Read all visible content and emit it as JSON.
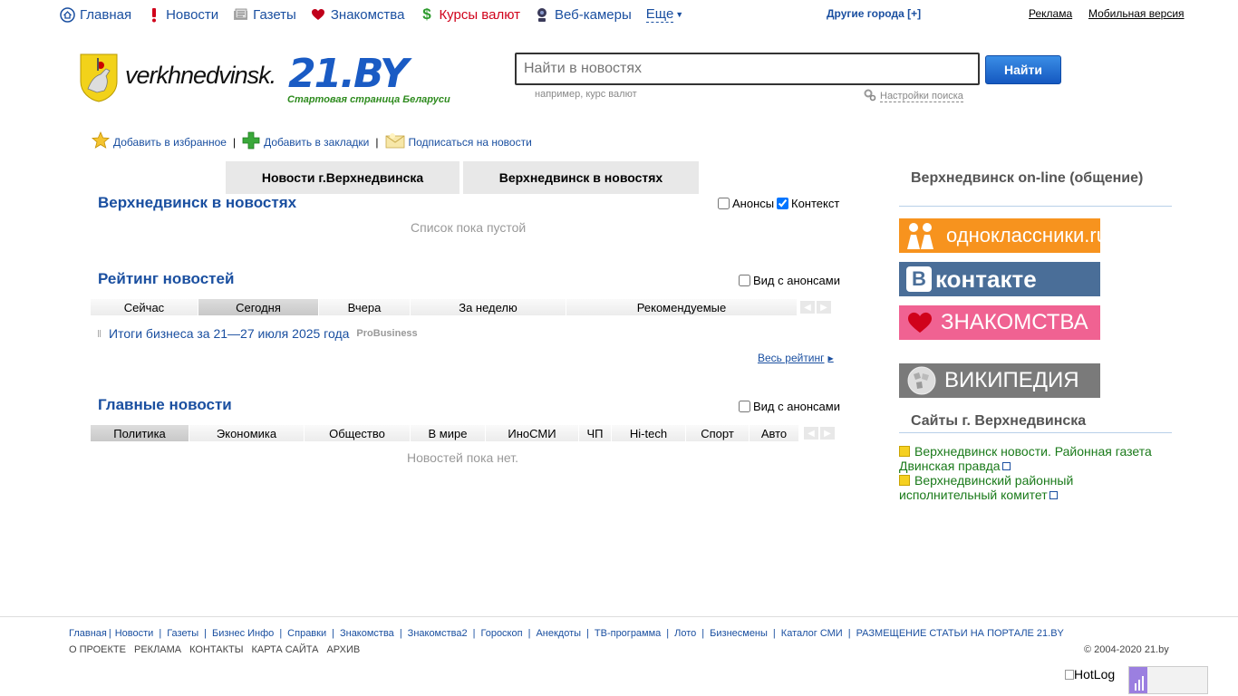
{
  "topnav": {
    "items": [
      {
        "label": "Главная",
        "icon": "home-icon",
        "color": "#1a4fa0"
      },
      {
        "label": "Новости",
        "icon": "exclamation-icon",
        "color": "#1a4fa0"
      },
      {
        "label": "Газеты",
        "icon": "newspaper-icon",
        "color": "#1a4fa0"
      },
      {
        "label": "Знакомства",
        "icon": "heart-icon",
        "color": "#1a4fa0"
      },
      {
        "label": "Курсы валют",
        "icon": "dollar-icon",
        "color": "#d0021b"
      },
      {
        "label": "Веб-камеры",
        "icon": "webcam-icon",
        "color": "#1a4fa0"
      }
    ],
    "more_label": "Еще",
    "other_cities": "Другие города [+]",
    "ads": "Реклама",
    "mobile": "Мобильная версия"
  },
  "logo": {
    "site_name": "verkhnedvinsk.",
    "brand": "21.BY",
    "tagline": "Стартовая страница Беларуси"
  },
  "search": {
    "placeholder": "Найти в новостях",
    "button": "Найти",
    "hint": "например, курс валют",
    "settings": "Настройки поиска"
  },
  "actions": {
    "favorites": "Добавить в избранное",
    "bookmarks": "Добавить в закладки",
    "subscribe": "Подписаться на новости"
  },
  "tabs": {
    "city_news": "Новости г.Верхнедвинска",
    "in_news": "Верхнедвинск в новостях"
  },
  "section_in_news": {
    "title": "Верхнедвинск в новостях",
    "announcements": "Анонсы",
    "context": "Контекст",
    "empty": "Список пока пустой"
  },
  "rating": {
    "title": "Рейтинг новостей",
    "with_announcements": "Вид с анонсами",
    "tabs": [
      "Сейчас",
      "Сегодня",
      "Вчера",
      "За неделю",
      "Рекомендуемые"
    ],
    "item_title": "Итоги бизнеса за 21—27 июля 2025 года",
    "item_source": "ProBusiness",
    "all": "Весь рейтинг"
  },
  "main_news": {
    "title": "Главные новости",
    "with_announcements": "Вид с анонсами",
    "tabs": [
      "Политика",
      "Экономика",
      "Общество",
      "В мире",
      "ИноСМИ",
      "ЧП",
      "Hi-tech",
      "Спорт",
      "Авто"
    ],
    "empty": "Новостей пока нет."
  },
  "right": {
    "online_title": "Верхнедвинск on-line (общение)",
    "banners": {
      "ok": "одноклассники.ru",
      "vk": "контакте",
      "dating": "ЗНАКОМСТВА",
      "wiki": "ВИКИПЕДИЯ"
    },
    "sites_title": "Сайты г. Верхнедвинска",
    "sites": [
      "Верхнедвинск новости. Районная газета Двинская правда",
      "Верхнедвинский районный исполнительный комитет"
    ]
  },
  "footer": {
    "links": [
      "Главная",
      "Новости",
      "Газеты",
      "Бизнес Инфо",
      "Справки",
      "Знакомства",
      "Знакомства2",
      "Гороскоп",
      "Анекдоты",
      "ТВ-программа",
      "Лото",
      "Бизнесмены",
      "Каталог СМИ",
      "РАЗМЕЩЕНИЕ СТАТЬИ НА ПОРТАЛЕ 21.BY"
    ],
    "links2": [
      "О ПРОЕКТЕ",
      "РЕКЛАМА",
      "КОНТАКТЫ",
      "КАРТА САЙТА",
      "АРХИВ"
    ],
    "copyright": "© 2004-2020 21.by",
    "hotlog": "HotLog"
  }
}
